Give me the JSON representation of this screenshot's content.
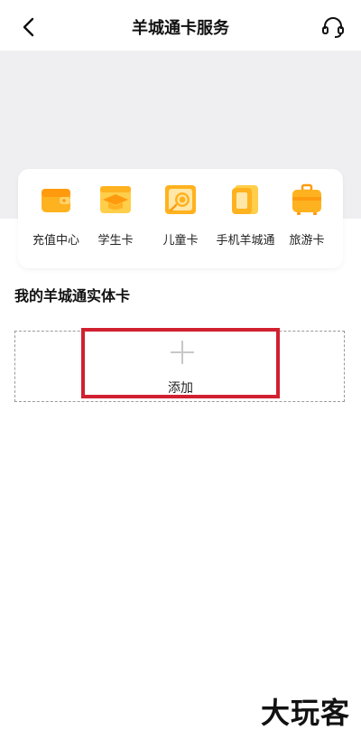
{
  "header": {
    "title": "羊城通卡服务"
  },
  "icons": {
    "back": "chevron-left-icon",
    "customer_service": "headset-icon"
  },
  "services": [
    {
      "label": "充值中心",
      "icon": "wallet-icon"
    },
    {
      "label": "学生卡",
      "icon": "graduation-cap-icon"
    },
    {
      "label": "儿童卡",
      "icon": "lollipop-icon"
    },
    {
      "label": "手机羊城通",
      "icon": "phone-card-icon"
    },
    {
      "label": "旅游卡",
      "icon": "suitcase-icon"
    }
  ],
  "section": {
    "title": "我的羊城通实体卡"
  },
  "add_card": {
    "label": "添加"
  },
  "watermark": {
    "text": "大玩客"
  },
  "colors": {
    "accent_orange": "#FFA21A",
    "highlight_red": "#D12030",
    "banner_gray": "#EFEFF2"
  }
}
